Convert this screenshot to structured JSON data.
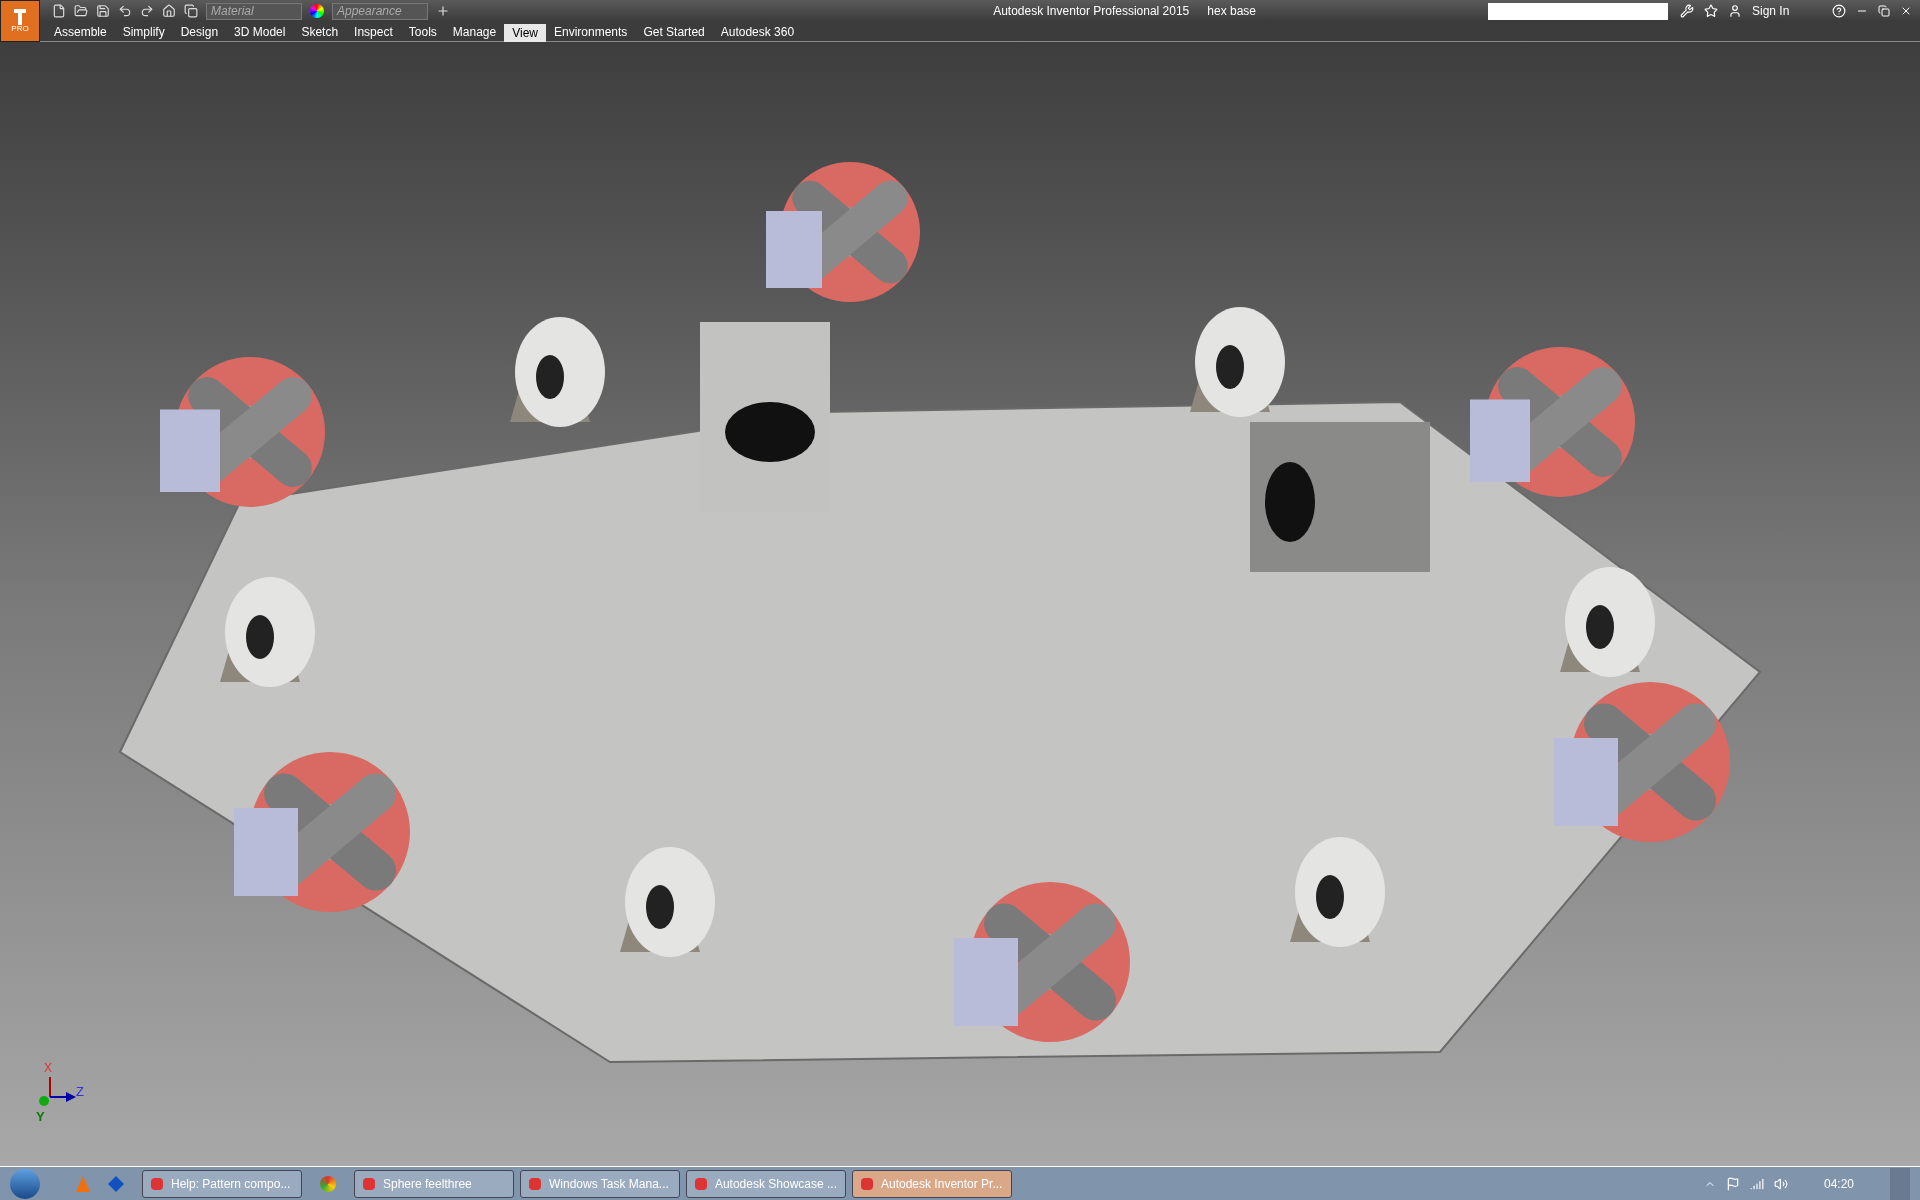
{
  "app_badge": "PRO",
  "quick_access": {
    "material": "Material",
    "appearance": "Appearance"
  },
  "window": {
    "title": "Autodesk Inventor Professional 2015",
    "document": "hex base"
  },
  "account": {
    "sign_in": "Sign In"
  },
  "ribbon_tabs": [
    {
      "label": "Assemble",
      "selected": false
    },
    {
      "label": "Simplify",
      "selected": false
    },
    {
      "label": "Design",
      "selected": false
    },
    {
      "label": "3D Model",
      "selected": false
    },
    {
      "label": "Sketch",
      "selected": false
    },
    {
      "label": "Inspect",
      "selected": false
    },
    {
      "label": "Tools",
      "selected": false
    },
    {
      "label": "Manage",
      "selected": false
    },
    {
      "label": "View",
      "selected": true
    },
    {
      "label": "Environments",
      "selected": false
    },
    {
      "label": "Get Started",
      "selected": false
    },
    {
      "label": "Autodesk 360",
      "selected": false
    }
  ],
  "axis_triad": {
    "x": "X",
    "y": "Y",
    "z": "Z"
  },
  "taskbar": {
    "items": [
      {
        "kind": "button",
        "label": "Help: Pattern compo...",
        "selected": false
      },
      {
        "kind": "icon",
        "selected": false
      },
      {
        "kind": "button",
        "label": "Sphere feelthree",
        "selected": false
      },
      {
        "kind": "button",
        "label": "Windows Task Mana...",
        "selected": false
      },
      {
        "kind": "button",
        "label": "Autodesk Showcase ...",
        "selected": false
      },
      {
        "kind": "button",
        "label": "Autodesk Inventor Pr...",
        "selected": true
      }
    ],
    "clock": "04:20"
  }
}
